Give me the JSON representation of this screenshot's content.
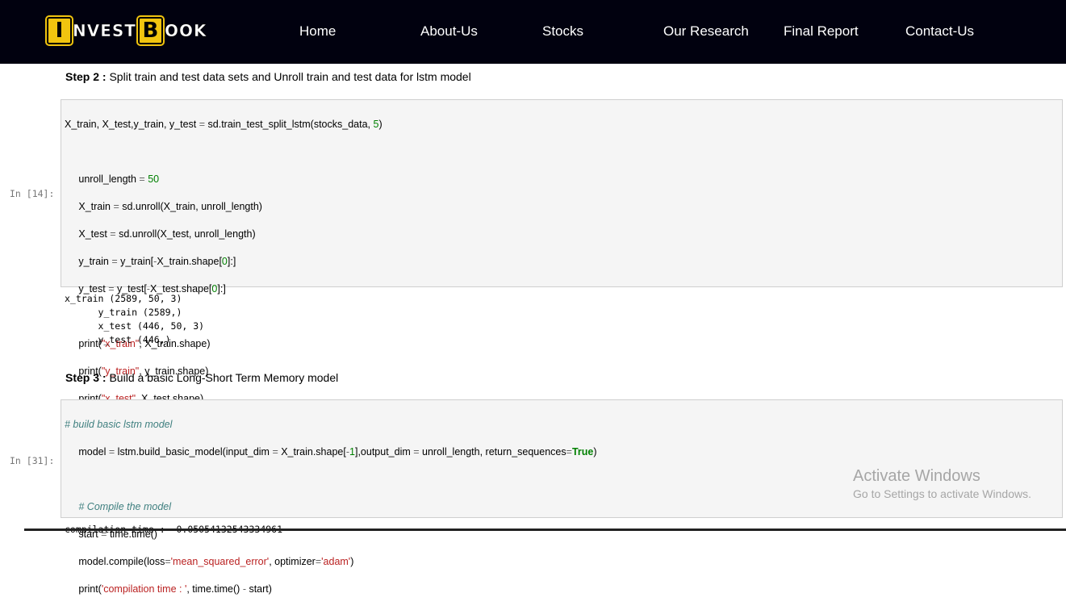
{
  "nav": {
    "logo": {
      "letter1": "I",
      "part1": "NVEST",
      "letter2": "B",
      "part2": "OOK"
    },
    "links": [
      "Home",
      "About-Us",
      "Stocks",
      "Our Research",
      "Final Report",
      "Contact-Us"
    ]
  },
  "step2": {
    "label": "Step 2 :",
    "text": " Split train and test data sets and Unroll train and test data for lstm model"
  },
  "cell14": {
    "prompt": "In [14]:",
    "output": [
      "x_train (2589, 50, 3)",
      "      y_train (2589,)",
      "      x_test (446, 50, 3)",
      "      y_test (446,)"
    ]
  },
  "step3": {
    "label": "Step 3 :",
    "text": " Build a basic Long-Short Term Memory model"
  },
  "cell31": {
    "prompt": "In [31]:",
    "output_partial": "compilation time :  0.05054132543334961"
  },
  "watermark": {
    "title": "Activate Windows",
    "subtitle": "Go to Settings to activate Windows."
  }
}
